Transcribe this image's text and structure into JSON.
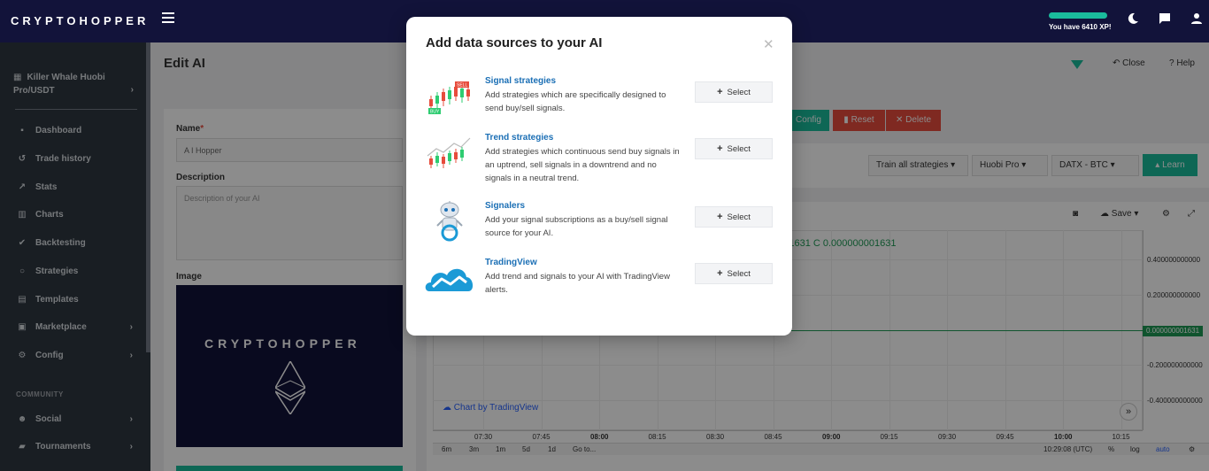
{
  "brand": {
    "logo_text": "CRYPTOHOPPER"
  },
  "topbar": {
    "xp_label": "You have 6410 XP!",
    "xp_fill_pct": 100
  },
  "sidebar": {
    "account": "Killer Whale Huobi Pro/USDT",
    "items": [
      {
        "label": "Dashboard",
        "icon": "dashboard-icon"
      },
      {
        "label": "Trade history",
        "icon": "history-icon"
      },
      {
        "label": "Stats",
        "icon": "stats-icon"
      },
      {
        "label": "Charts",
        "icon": "charts-icon"
      },
      {
        "label": "Backtesting",
        "icon": "backtesting-icon"
      },
      {
        "label": "Strategies",
        "icon": "strategies-icon"
      },
      {
        "label": "Templates",
        "icon": "templates-icon"
      },
      {
        "label": "Marketplace",
        "icon": "marketplace-icon"
      },
      {
        "label": "Config",
        "icon": "config-icon"
      }
    ],
    "community_heading": "COMMUNITY",
    "community_items": [
      {
        "label": "Social",
        "icon": "social-icon"
      },
      {
        "label": "Tournaments",
        "icon": "tournaments-icon"
      }
    ]
  },
  "page": {
    "title": "Edit AI",
    "close_label": "Close",
    "help_label": "Help"
  },
  "form": {
    "name_label": "Name",
    "name_value": "A I Hopper",
    "description_label": "Description",
    "description_placeholder": "Description of your AI",
    "image_label": "Image"
  },
  "actions": {
    "config_label": "Config",
    "reset_label": "Reset",
    "delete_label": "Delete"
  },
  "toolbar": {
    "train_label": "Train all strategies",
    "exchange_label": "Huobi Pro",
    "pair_label": "DATX - BTC",
    "learn_label": "Learn"
  },
  "chart": {
    "save_label": "Save",
    "ohlc_text": "0001631  C 0.000000001631",
    "credit": "Chart by TradingView",
    "y_ticks": [
      "0.400000000000",
      "0.200000000000",
      "-0.200000000000",
      "-0.400000000000"
    ],
    "price_tag": "0.000000001631",
    "x_ticks": [
      "07:30",
      "07:45",
      "08:00",
      "08:15",
      "08:30",
      "08:45",
      "09:00",
      "09:15",
      "09:30",
      "09:45",
      "10:00",
      "10:15"
    ],
    "ranges": [
      "6m",
      "3m",
      "1m",
      "5d",
      "1d",
      "Go to..."
    ],
    "clock": "10:29:08 (UTC)",
    "pct": "%",
    "log": "log",
    "auto": "auto"
  },
  "modal": {
    "title": "Add data sources to your AI",
    "select_label": "Select",
    "rows": [
      {
        "title": "Signal strategies",
        "desc": "Add strategies which are specifically designed to send buy/sell signals.",
        "icon": "candlestick-signal-icon"
      },
      {
        "title": "Trend strategies",
        "desc": "Add strategies which continuous send buy signals in an uptrend, sell signals in a downtrend and no signals in a neutral trend.",
        "icon": "trend-chart-icon"
      },
      {
        "title": "Signalers",
        "desc": "Add your signal subscriptions as a buy/sell signal source for your AI.",
        "icon": "robot-icon"
      },
      {
        "title": "TradingView",
        "desc": "Add trend and signals to your AI with TradingView alerts.",
        "icon": "tradingview-cloud-icon"
      }
    ],
    "signal_icon_labels": {
      "sell": "SELL",
      "buy": "BUY"
    }
  }
}
